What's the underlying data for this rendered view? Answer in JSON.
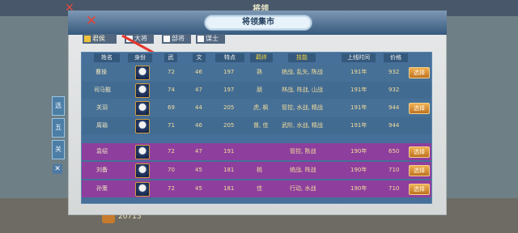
{
  "background": {
    "top_title": "将领",
    "resource_count": "20715"
  },
  "sidebar": [
    {
      "label": "选战"
    },
    {
      "label": "五战"
    },
    {
      "label": "关"
    },
    {
      "label": "✕"
    }
  ],
  "dialog": {
    "title": "将领集市",
    "close_label": "✕"
  },
  "filters": [
    {
      "label": "君侯",
      "active": true
    },
    {
      "label": "大将",
      "active": false
    },
    {
      "label": "部将",
      "active": false
    },
    {
      "label": "谋士",
      "active": false
    }
  ],
  "table": {
    "headers": [
      "姓名",
      "身份",
      "武",
      "文",
      "特点",
      "羁绊",
      "技能",
      "上线时间",
      "价格"
    ],
    "rows": [
      {
        "name": "曹操",
        "wu": "72",
        "wen": "46",
        "point": "197",
        "bond": "熟",
        "skill": "统战, 乱矢, 陈战",
        "time": "191年",
        "price": "932",
        "action": "选择"
      },
      {
        "name": "司马懿",
        "wu": "74",
        "wen": "47",
        "point": "197",
        "bond": "朋",
        "skill": "林战, 阵战, 山战",
        "time": "191年",
        "price": "932",
        "action": ""
      },
      {
        "name": "关羽",
        "wu": "69",
        "wen": "44",
        "point": "205",
        "bond": "虎, 枫",
        "skill": "管控, 水战, 精战",
        "time": "191年",
        "price": "944",
        "action": "选择"
      },
      {
        "name": "周瑜",
        "wu": "71",
        "wen": "46",
        "point": "205",
        "bond": "督, 佳",
        "skill": "武阶, 水战, 精战",
        "time": "191年",
        "price": "944",
        "action": ""
      },
      {
        "name": "袁绍",
        "wu": "72",
        "wen": "47",
        "point": "191",
        "bond": "",
        "skill": "管控, 陈战",
        "time": "190年",
        "price": "650",
        "action": "选择"
      },
      {
        "name": "刘备",
        "wu": "70",
        "wen": "45",
        "point": "181",
        "bond": "桃",
        "skill": "统战, 阵战",
        "time": "190年",
        "price": "710",
        "action": "选择"
      },
      {
        "name": "孙策",
        "wu": "72",
        "wen": "45",
        "point": "181",
        "bond": "佳",
        "skill": "行动, 水战",
        "time": "190年",
        "price": "710",
        "action": "选择"
      }
    ]
  },
  "colors": {
    "highlight_red": "#e24a3e",
    "row_blue": "#466f99",
    "row_purple": "#8e3f9d",
    "button_orange": "#d8892f"
  }
}
